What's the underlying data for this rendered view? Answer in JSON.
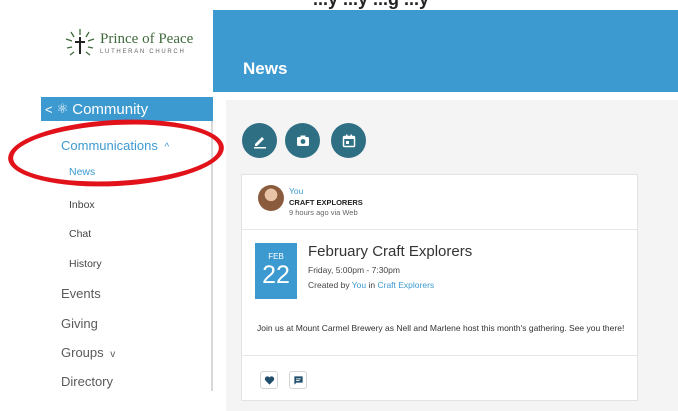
{
  "logo": {
    "name": "Prince of Peace",
    "subtitle": "LUTHERAN CHURCH"
  },
  "top_strip_text": "...y ...y ...g ...y",
  "header": {
    "title": "News"
  },
  "sidebar": {
    "community_label": "Community",
    "communications_label": "Communications",
    "communications_chevron": "^",
    "sub_items": [
      "News",
      "Inbox",
      "Chat",
      "History"
    ],
    "nav_items": [
      "Events",
      "Giving",
      "Groups",
      "Directory"
    ],
    "groups_chevron": "v"
  },
  "actions": {
    "icons": [
      "pencil-icon",
      "camera-icon",
      "calendar-icon"
    ],
    "button_color": "#2e6f83"
  },
  "post": {
    "author": "You",
    "group": "CRAFT EXPLORERS",
    "time": "9 hours ago via Web",
    "event": {
      "month": "FEB",
      "day": "22",
      "title": "February Craft Explorers",
      "time": "Friday, 5:00pm - 7:30pm",
      "created_prefix": "Created by ",
      "created_by": "You",
      "created_in": " in ",
      "created_group": "Craft Explorers"
    },
    "description": "Join us at Mount Carmel Brewery as Nell and Marlene host this month's gathering. See you there!"
  },
  "colors": {
    "accent": "#3d9ad1",
    "annotation": "#e2121b"
  }
}
